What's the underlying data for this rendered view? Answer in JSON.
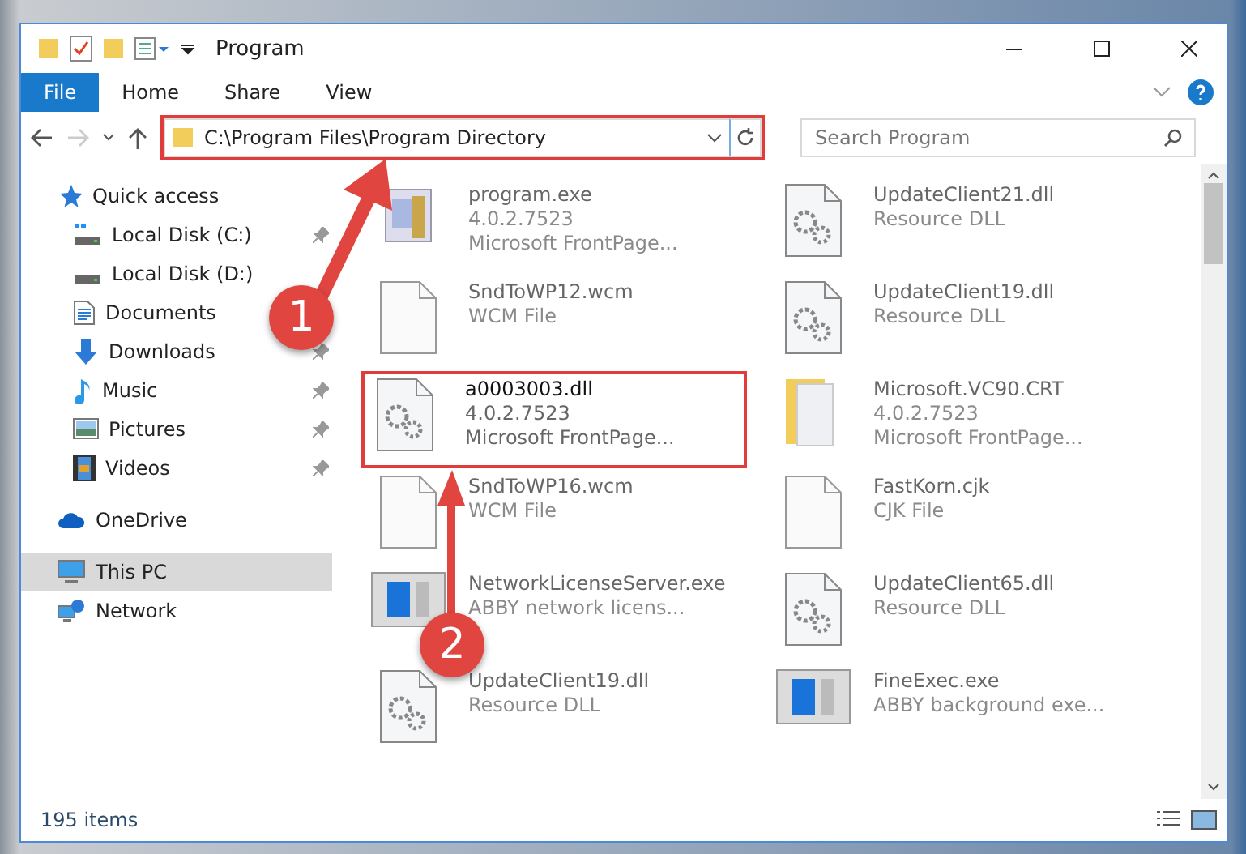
{
  "window": {
    "title": "Program"
  },
  "ribbon_tabs": [
    {
      "label": "File",
      "selected": true
    },
    {
      "label": "Home",
      "selected": false
    },
    {
      "label": "Share",
      "selected": false
    },
    {
      "label": "View",
      "selected": false
    }
  ],
  "address": {
    "value": "C:\\Program Files\\Program Directory",
    "highlighted": true
  },
  "search": {
    "placeholder": "Search Program"
  },
  "sidebar": {
    "items": [
      {
        "label": "Quick access",
        "kind": "star",
        "selected": false,
        "children": [
          {
            "label": "Local Disk (C:)",
            "kind": "disk-c",
            "pinned": true,
            "selected": false
          },
          {
            "label": "Local Disk (D:)",
            "kind": "disk",
            "pinned": false,
            "selected": false
          },
          {
            "label": "Documents",
            "kind": "documents",
            "pinned": false,
            "selected": false
          },
          {
            "label": "Downloads",
            "kind": "download",
            "pinned": true,
            "selected": false
          },
          {
            "label": "Music",
            "kind": "music",
            "pinned": true,
            "selected": false
          },
          {
            "label": "Pictures",
            "kind": "pictures",
            "pinned": true,
            "selected": false
          },
          {
            "label": "Videos",
            "kind": "videos",
            "pinned": true,
            "selected": false
          }
        ]
      },
      {
        "label": "OneDrive",
        "kind": "cloud",
        "selected": false
      },
      {
        "label": "This PC",
        "kind": "pc",
        "selected": true
      },
      {
        "label": "Network",
        "kind": "network",
        "selected": false
      }
    ]
  },
  "files": [
    {
      "name": "program.exe",
      "lines": [
        "4.0.2.7523",
        "Microsoft FrontPage..."
      ],
      "kind": "program",
      "highlighted": false
    },
    {
      "name": "UpdateClient21.dll",
      "lines": [
        "Resource DLL"
      ],
      "kind": "gear",
      "highlighted": false
    },
    {
      "name": "SndToWP12.wcm",
      "lines": [
        "WCM File"
      ],
      "kind": "blank",
      "highlighted": false
    },
    {
      "name": "UpdateClient19.dll",
      "lines": [
        "Resource DLL"
      ],
      "kind": "gear",
      "highlighted": false
    },
    {
      "name": "a0003003.dll",
      "lines": [
        "4.0.2.7523",
        "Microsoft FrontPage..."
      ],
      "kind": "gear",
      "highlighted": true
    },
    {
      "name": "Microsoft.VC90.CRT",
      "lines": [
        "4.0.2.7523",
        "Microsoft FrontPage..."
      ],
      "kind": "folder",
      "highlighted": false
    },
    {
      "name": "SndToWP16.wcm",
      "lines": [
        "WCM File"
      ],
      "kind": "blank",
      "highlighted": false
    },
    {
      "name": "FastKorn.cjk",
      "lines": [
        "CJK File"
      ],
      "kind": "blank",
      "highlighted": false
    },
    {
      "name": "NetworkLicenseServer.exe",
      "lines": [
        "ABBY network licens..."
      ],
      "kind": "window",
      "highlighted": false
    },
    {
      "name": "UpdateClient65.dll",
      "lines": [
        "Resource DLL"
      ],
      "kind": "gear",
      "highlighted": false
    },
    {
      "name": "UpdateClient19.dll",
      "lines": [
        "Resource DLL"
      ],
      "kind": "gear",
      "highlighted": false
    },
    {
      "name": "FineExec.exe",
      "lines": [
        "ABBY background exe..."
      ],
      "kind": "window",
      "highlighted": false
    }
  ],
  "status_bar": {
    "count": "195 items"
  },
  "callouts": [
    {
      "number": "1"
    },
    {
      "number": "2"
    }
  ]
}
